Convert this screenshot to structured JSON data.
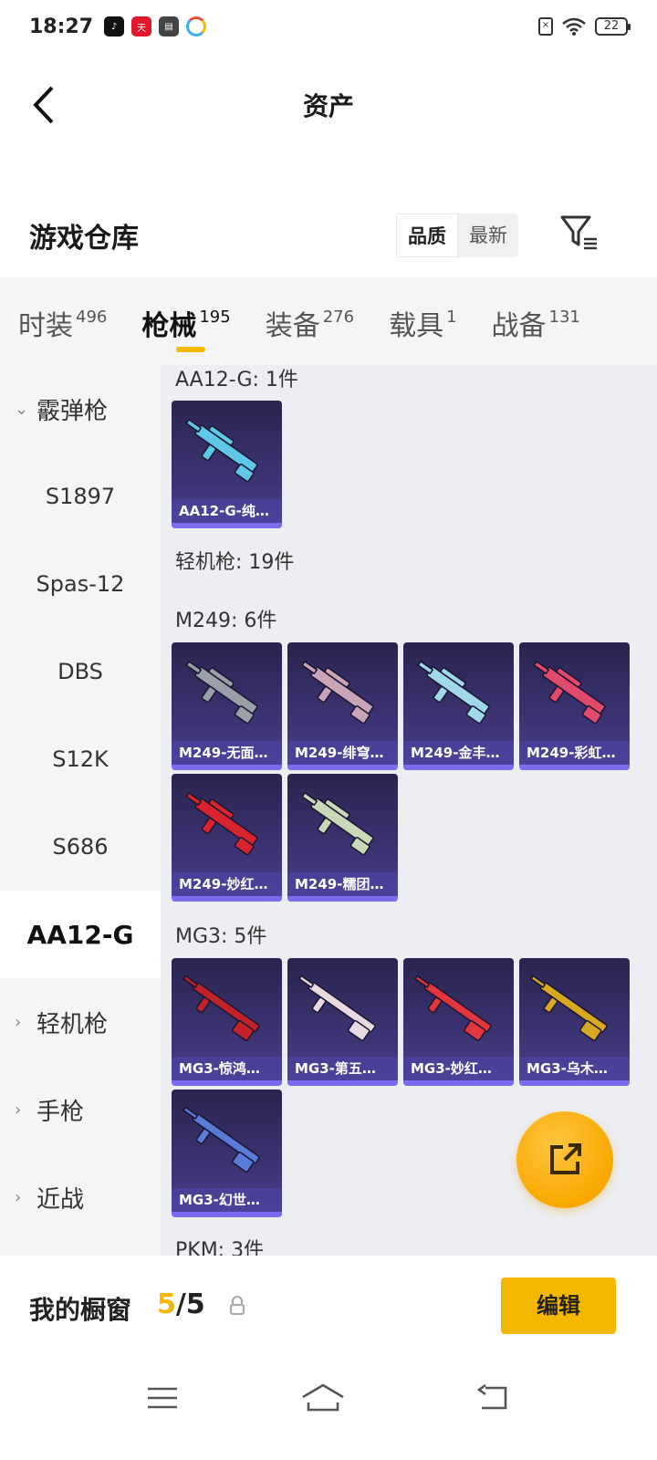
{
  "status": {
    "time": "18:27",
    "battery": "22",
    "app_icons": [
      "tiktok-icon",
      "tianmao-icon",
      "wallet-icon",
      "app-icon"
    ]
  },
  "header": {
    "title": "资产"
  },
  "section": {
    "title": "游戏仓库",
    "sort_options": [
      "品质",
      "最新"
    ],
    "active_sort": "品质"
  },
  "tabs": [
    {
      "label": "时装",
      "count": "496"
    },
    {
      "label": "枪械",
      "count": "195",
      "active": true
    },
    {
      "label": "装备",
      "count": "276"
    },
    {
      "label": "载具",
      "count": "1"
    },
    {
      "label": "战备",
      "count": "131"
    }
  ],
  "sidebar": {
    "items": [
      {
        "label": "霰弹枪",
        "type": "parent",
        "expanded": true
      },
      {
        "label": "S1897",
        "type": "child"
      },
      {
        "label": "Spas-12",
        "type": "child"
      },
      {
        "label": "DBS",
        "type": "child"
      },
      {
        "label": "S12K",
        "type": "child"
      },
      {
        "label": "S686",
        "type": "child"
      },
      {
        "label": "AA12-G",
        "type": "child",
        "selected": true
      },
      {
        "label": "轻机枪",
        "type": "parent",
        "expanded": false
      },
      {
        "label": "手枪",
        "type": "parent",
        "expanded": false
      },
      {
        "label": "近战",
        "type": "parent",
        "expanded": false
      }
    ]
  },
  "groups": [
    {
      "label": "AA12-G: 1件",
      "items": [
        {
          "name": "AA12-G-纯…",
          "accent": "#5fc8e6"
        }
      ]
    },
    {
      "label": "轻机枪: 19件",
      "items": []
    },
    {
      "label": "M249: 6件",
      "items": [
        {
          "name": "M249-无面…",
          "accent": "#9aa0a8"
        },
        {
          "name": "M249-绯穹…",
          "accent": "#c9a3b8"
        },
        {
          "name": "M249-金丰…",
          "accent": "#9fd8e8"
        },
        {
          "name": "M249-彩虹…",
          "accent": "#e14a6a"
        },
        {
          "name": "M249-妙红…",
          "accent": "#d8242e"
        },
        {
          "name": "M249-糯团…",
          "accent": "#c8d8b8"
        }
      ]
    },
    {
      "label": "MG3: 5件",
      "items": [
        {
          "name": "MG3-惊鸿…",
          "accent": "#c2222a"
        },
        {
          "name": "MG3-第五…",
          "accent": "#e8d8e0"
        },
        {
          "name": "MG3-妙红…",
          "accent": "#e0363c"
        },
        {
          "name": "MG3-乌木…",
          "accent": "#d8a820"
        },
        {
          "name": "MG3-幻世…",
          "accent": "#5a7ad8"
        }
      ]
    },
    {
      "label": "PKM: 3件",
      "items": []
    }
  ],
  "showcase": {
    "label": "我的橱窗",
    "current": "5",
    "total": "/5",
    "edit_label": "编辑"
  }
}
